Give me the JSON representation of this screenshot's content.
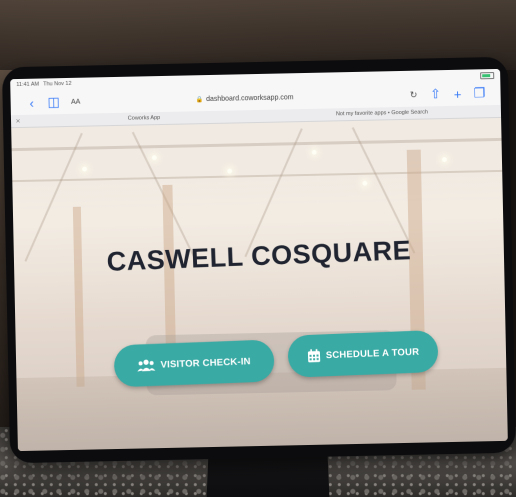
{
  "status_bar": {
    "time": "11:41 AM",
    "date": "Thu Nov 12"
  },
  "browser": {
    "url": "dashboard.coworksapp.com",
    "reader_label": "AA",
    "tabs": [
      {
        "title": "Coworks App"
      },
      {
        "title": "Not my favorite apps • Google Search"
      }
    ]
  },
  "page": {
    "title": "CASWELL COSQUARE",
    "buttons": {
      "checkin": "VISITOR CHECK-IN",
      "tour": "SCHEDULE A TOUR"
    }
  },
  "colors": {
    "accent": "#3aaaa4",
    "title": "#1f2430"
  },
  "icons": {
    "back": "chevron-left-icon",
    "bookmarks": "book-icon",
    "lock": "lock-icon",
    "reload": "reload-icon",
    "share": "share-icon",
    "new_tab": "plus-icon",
    "tabs": "tabs-icon",
    "checkin": "users-icon",
    "tour": "calendar-icon"
  }
}
